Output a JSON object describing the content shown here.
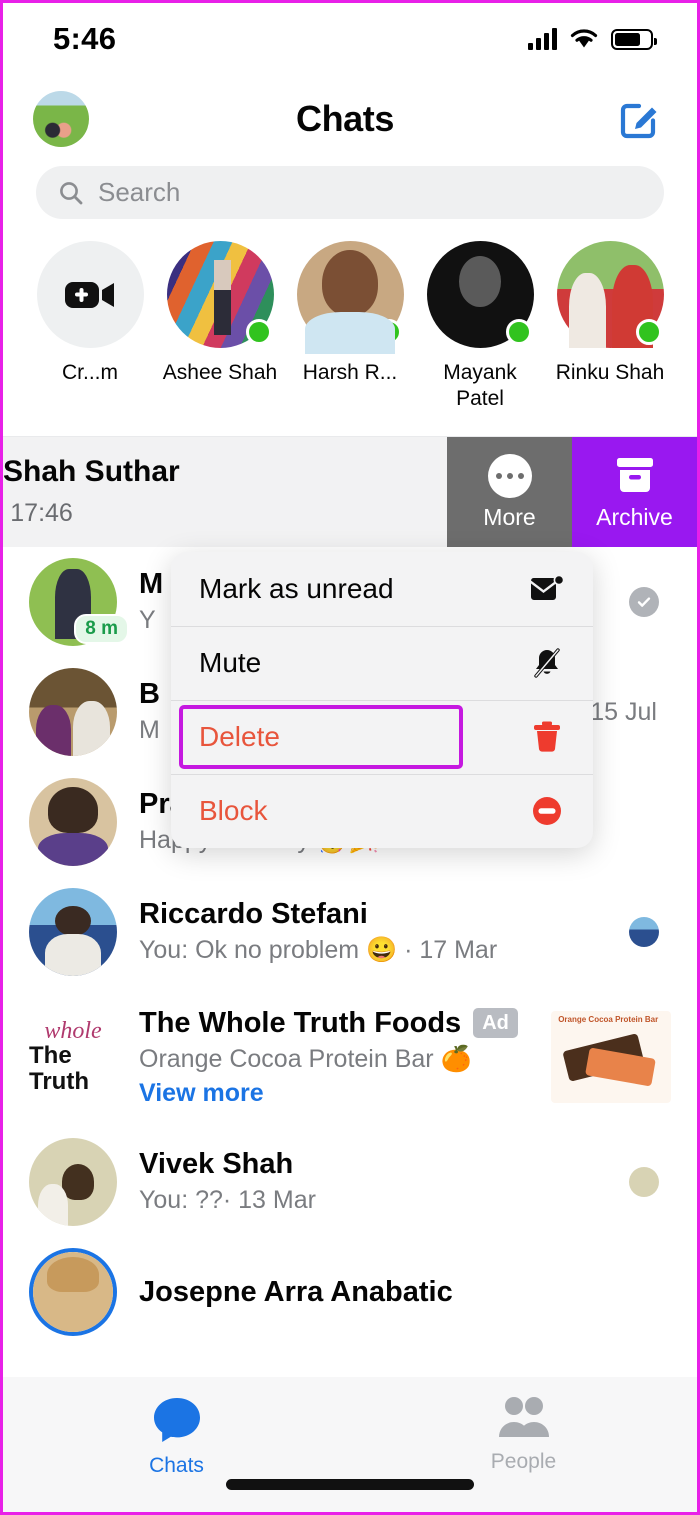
{
  "status_bar": {
    "time": "5:46",
    "icons": [
      "cellular-signal-icon",
      "wifi-icon",
      "battery-icon"
    ]
  },
  "header": {
    "title": "Chats",
    "profile_avatar_name": "user-profile-avatar",
    "compose_icon": "compose-new-message-icon"
  },
  "search": {
    "placeholder": "Search",
    "icon": "search-icon"
  },
  "stories": {
    "create_room": {
      "label": "Cr...m",
      "icon": "create-room-video-icon"
    },
    "items": [
      {
        "label": "Ashee Shah",
        "online": true
      },
      {
        "label": "Harsh R...",
        "online": true
      },
      {
        "label": "Mayank Patel",
        "online": true
      },
      {
        "label": "Rinku Shah",
        "online": true
      }
    ]
  },
  "swiped_row": {
    "name": "Shah Suthar",
    "snippet": "· 17:46",
    "actions": [
      {
        "label": "More",
        "icon": "more-ellipsis-icon",
        "color": "#6d6d6d"
      },
      {
        "label": "Archive",
        "icon": "archive-box-icon",
        "color": "#9918f0"
      }
    ]
  },
  "context_menu": {
    "items": [
      {
        "label": "Mark as unread",
        "icon": "mail-unread-icon",
        "danger": false,
        "highlighted": false
      },
      {
        "label": "Mute",
        "icon": "bell-slash-icon",
        "danger": false,
        "highlighted": false
      },
      {
        "label": "Delete",
        "icon": "trash-icon",
        "danger": true,
        "highlighted": true
      },
      {
        "label": "Block",
        "icon": "block-circle-icon",
        "danger": true,
        "highlighted": false
      }
    ],
    "highlight_color": "#c518e0"
  },
  "chats": [
    {
      "name": "M",
      "snippet": "Y",
      "time_badge": "8 m",
      "right_icon": "seen-check-icon",
      "obscured": true
    },
    {
      "name": "B",
      "snippet": "M",
      "time": "· 15 Jul",
      "right_icon": "",
      "obscured": true
    },
    {
      "name": "Pratik Shah",
      "snippet": "Happy Birthday 🥳🎉· 15 Jul",
      "right_icon": ""
    },
    {
      "name": "Riccardo Stefani",
      "snippet": "You: Ok no problem 😀 · 17 Mar",
      "right_icon": "seen-mini-avatar"
    },
    {
      "name": "Vivek Shah",
      "snippet": "You: ??· 13 Mar",
      "right_icon": "seen-mini-avatar"
    },
    {
      "name": "Josepne Arra Anabatic",
      "snippet": "",
      "right_icon": ""
    }
  ],
  "ad": {
    "advertiser": "The Whole Truth Foods",
    "badge": "Ad",
    "subtitle": "Orange Cocoa Protein Bar 🍊",
    "link": "View more",
    "logo_line1": "whole",
    "logo_line2": "The Truth",
    "thumb_caption": "Orange Cocoa Protein Bar"
  },
  "tabbar": {
    "tabs": [
      {
        "label": "Chats",
        "icon": "chat-bubble-icon",
        "active": true
      },
      {
        "label": "People",
        "icon": "people-icon",
        "active": false
      }
    ],
    "active_color": "#1b74e4",
    "inactive_color": "#a9acb1"
  },
  "colors": {
    "screen_border": "#e820e8",
    "archive_purple": "#9918f0",
    "more_gray": "#6d6d6d",
    "danger_red": "#e8553c",
    "link_blue": "#1b74e4",
    "online_green": "#31c31f"
  }
}
